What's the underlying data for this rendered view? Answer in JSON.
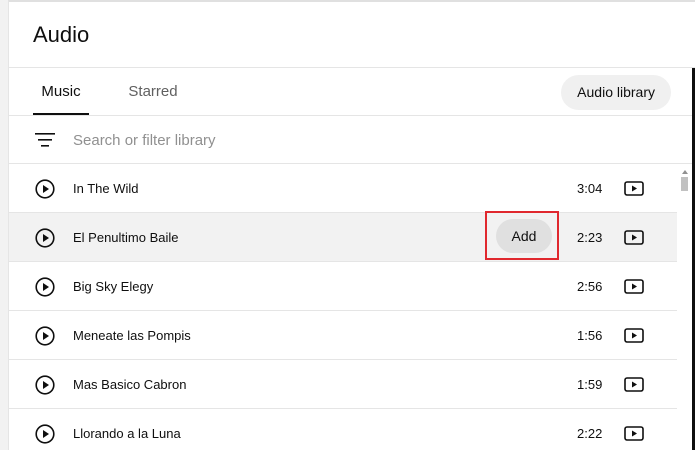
{
  "header": {
    "title": "Audio"
  },
  "tabs": [
    {
      "label": "Music",
      "active": true
    },
    {
      "label": "Starred",
      "active": false
    }
  ],
  "audio_library_button": "Audio library",
  "filter": {
    "placeholder": "Search or filter library",
    "value": "",
    "icon": "filter-icon"
  },
  "tracks": [
    {
      "title": "In The Wild",
      "duration": "3:04"
    },
    {
      "title": "El Penultimo Baile",
      "duration": "2:23",
      "hovered": true,
      "action": "Add"
    },
    {
      "title": "Big Sky Elegy",
      "duration": "2:56"
    },
    {
      "title": "Meneate las Pompis",
      "duration": "1:56"
    },
    {
      "title": "Mas Basico Cabron",
      "duration": "1:59"
    },
    {
      "title": "Llorando a la Luna",
      "duration": "2:22"
    }
  ],
  "colors": {
    "highlight_border": "#e0282e",
    "hover_row": "#f2f2f2"
  }
}
